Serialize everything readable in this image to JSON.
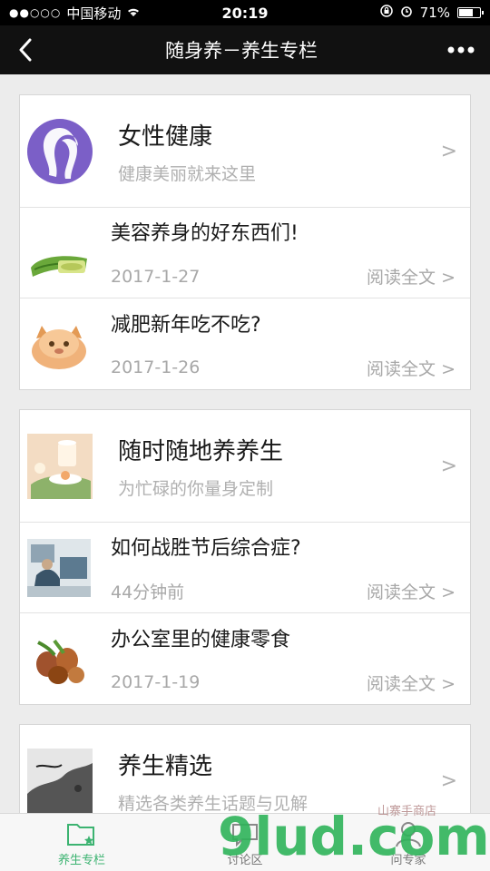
{
  "status": {
    "carrier": "中国移动",
    "time": "20:19",
    "battery": "71%"
  },
  "nav": {
    "title": "随身养－养生专栏",
    "back_icon": "chevron-left-icon",
    "more_icon": "more-dots-icon"
  },
  "cards": [
    {
      "title": "女性健康",
      "subtitle": "健康美丽就来这里",
      "articles": [
        {
          "title": "美容养身的好东西们!",
          "date": "2017-1-27",
          "read": "阅读全文 >"
        },
        {
          "title": "减肥新年吃不吃?",
          "date": "2017-1-26",
          "read": "阅读全文 >"
        }
      ]
    },
    {
      "title": "随时随地养养生",
      "subtitle": "为忙碌的你量身定制",
      "articles": [
        {
          "title": "如何战胜节后综合症?",
          "date": "44分钟前",
          "read": "阅读全文 >"
        },
        {
          "title": "办公室里的健康零食",
          "date": "2017-1-19",
          "read": "阅读全文 >"
        }
      ]
    },
    {
      "title": "养生精选",
      "subtitle": "精选各类养生话题与见解",
      "articles": []
    }
  ],
  "chevron": ">",
  "tabs": [
    {
      "label": "养生专栏",
      "active": true
    },
    {
      "label": "讨论区",
      "active": false
    },
    {
      "label": "问专家",
      "active": false
    }
  ],
  "watermark": {
    "text": "9lud.com",
    "small": "山寨手商店"
  },
  "colors": {
    "accent": "#3cb371",
    "purple": "#7b5fc7",
    "header_bg": "#111111"
  }
}
